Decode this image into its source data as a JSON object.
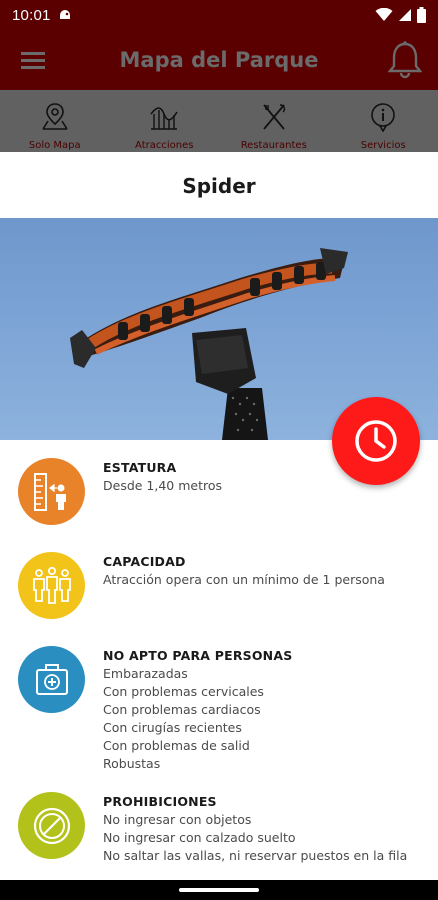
{
  "status_bar": {
    "time": "10:01"
  },
  "app_bar": {
    "title": "Mapa del Parque"
  },
  "tabs": [
    {
      "label": "Solo Mapa",
      "icon": "map-pin-icon"
    },
    {
      "label": "Atracciones",
      "icon": "roller-coaster-icon"
    },
    {
      "label": "Restaurantes",
      "icon": "cutlery-icon"
    },
    {
      "label": "Servicios",
      "icon": "info-icon"
    }
  ],
  "sheet": {
    "title": "Spider",
    "fab_icon": "clock-icon",
    "info": [
      {
        "heading": "ESTATURA",
        "lines": [
          "Desde 1,40 metros"
        ],
        "color": "#e8832a",
        "icon": "height-ruler-icon"
      },
      {
        "heading": "CAPACIDAD",
        "lines": [
          "Atracción opera con un mínimo de 1 persona"
        ],
        "color": "#f2c419",
        "icon": "group-people-icon"
      },
      {
        "heading": "NO APTO PARA PERSONAS",
        "lines": [
          "Embarazadas",
          "Con problemas cervicales",
          "Con problemas cardiacos",
          "Con cirugías recientes",
          "Con problemas de salid",
          "Robustas"
        ],
        "color": "#2a8fc0",
        "icon": "first-aid-kit-icon"
      },
      {
        "heading": "PROHIBICIONES",
        "lines": [
          "No ingresar con objetos",
          "No ingresar con calzado suelto",
          "No saltar las vallas, ni reservar puestos en la fila"
        ],
        "color": "#b3c21a",
        "icon": "prohibited-icon"
      }
    ]
  },
  "colors": {
    "app_bar": "#5a0000",
    "fab": "#ff1a1a",
    "tabs_overlay": "#616161"
  }
}
